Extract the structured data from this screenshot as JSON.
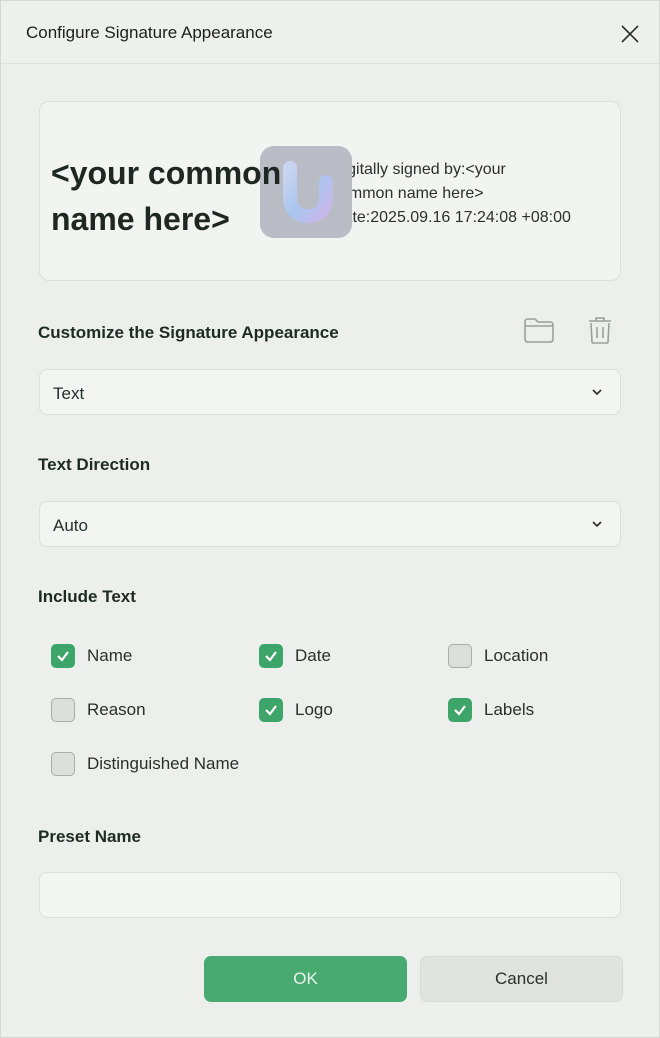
{
  "window": {
    "title": "Configure Signature Appearance"
  },
  "preview": {
    "name": "<your common name here>",
    "details_line1": "Digitally signed by:<your",
    "details_line2": "common name here>",
    "details_line3": "Date:2025.09.16 17:24:08 +08:00"
  },
  "appearance": {
    "label": "Customize the Signature Appearance",
    "selected": "Text"
  },
  "direction": {
    "label": "Text Direction",
    "selected": "Auto"
  },
  "include": {
    "label": "Include Text",
    "items": [
      {
        "label": "Name",
        "checked": true
      },
      {
        "label": "Date",
        "checked": true
      },
      {
        "label": "Location",
        "checked": false
      },
      {
        "label": "Reason",
        "checked": false
      },
      {
        "label": "Logo",
        "checked": true
      },
      {
        "label": "Labels",
        "checked": true
      },
      {
        "label": "Distinguished Name",
        "checked": false
      }
    ]
  },
  "preset": {
    "label": "Preset Name",
    "value": ""
  },
  "buttons": {
    "ok": "OK",
    "cancel": "Cancel"
  },
  "colors": {
    "accent": "#48aa71",
    "check": "#3ea56a"
  },
  "icons": {
    "close": "close-icon",
    "folder": "folder-icon",
    "trash": "trash-icon",
    "chevron": "chevron-down-icon",
    "check": "checkmark-icon"
  }
}
